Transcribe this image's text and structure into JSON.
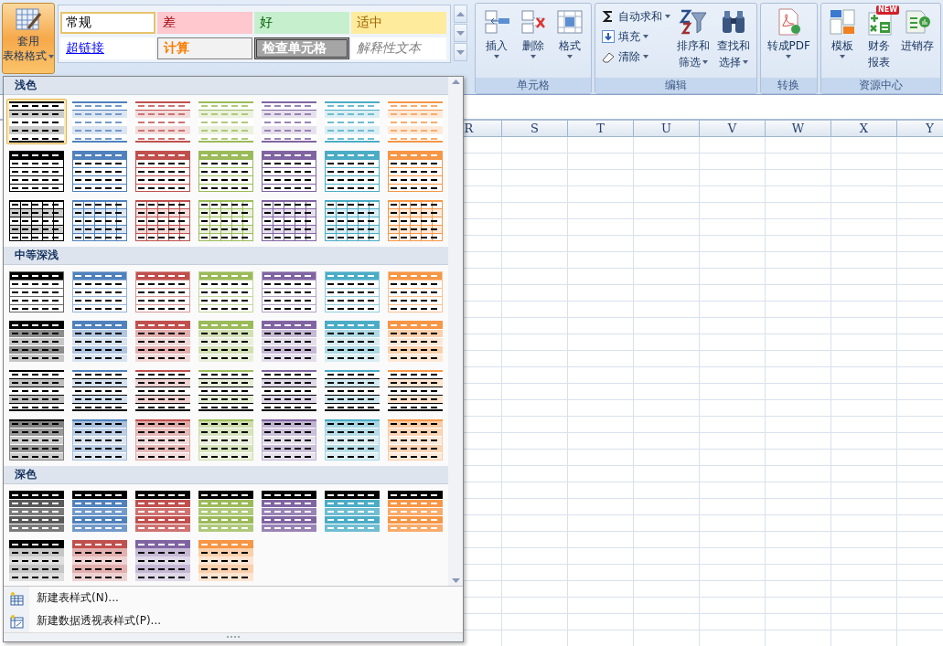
{
  "ribbon": {
    "format_as_table": {
      "lines": [
        "套用",
        "表格格式"
      ],
      "pressed": true,
      "dropdown": true
    },
    "cell_styles": [
      {
        "label": "常规",
        "kind": "normal",
        "selected": true
      },
      {
        "label": "差",
        "kind": "bad",
        "selected": false
      },
      {
        "label": "好",
        "kind": "good",
        "selected": false
      },
      {
        "label": "适中",
        "kind": "neutral",
        "selected": false
      },
      {
        "label": "超链接",
        "kind": "hyperlink",
        "selected": false
      },
      {
        "label": "计算",
        "kind": "calculation",
        "selected": false
      },
      {
        "label": "检查单元格",
        "kind": "check",
        "selected": false
      },
      {
        "label": "解释性文本",
        "kind": "explanatory",
        "selected": false
      }
    ],
    "groups": [
      {
        "label": "单元格",
        "buttons": [
          {
            "kind": "insert",
            "lines": [
              "插入"
            ],
            "dropdown": true
          },
          {
            "kind": "delete",
            "lines": [
              "删除"
            ],
            "dropdown": true
          },
          {
            "kind": "format",
            "lines": [
              "格式"
            ],
            "dropdown": true
          }
        ]
      },
      {
        "label": "编辑",
        "small_buttons": [
          {
            "kind": "sum",
            "label": "自动求和",
            "dropdown": true
          },
          {
            "kind": "fill",
            "label": "填充",
            "dropdown": true
          },
          {
            "kind": "clear",
            "label": "清除",
            "dropdown": true
          }
        ],
        "buttons": [
          {
            "kind": "sort",
            "lines": [
              "排序和",
              "筛选"
            ],
            "dropdown": true
          },
          {
            "kind": "find",
            "lines": [
              "查找和",
              "选择"
            ],
            "dropdown": true
          }
        ]
      },
      {
        "label": "转换",
        "buttons": [
          {
            "kind": "pdf",
            "lines": [
              "转成PDF"
            ],
            "dropdown": true
          }
        ]
      },
      {
        "label": "资源中心",
        "buttons": [
          {
            "kind": "template",
            "lines": [
              "模板"
            ],
            "dropdown": true
          },
          {
            "kind": "finance",
            "lines": [
              "财务",
              "报表"
            ],
            "dropdown": false,
            "badge": "NEW"
          },
          {
            "kind": "inventory",
            "lines": [
              "进销存"
            ],
            "dropdown": false
          }
        ]
      }
    ]
  },
  "sheet": {
    "columns": [
      "R",
      "S",
      "T",
      "U",
      "V",
      "W",
      "X",
      "Y"
    ]
  },
  "table_style_menu": {
    "sections": [
      {
        "title": "浅色",
        "styles": [
          {
            "kind": "light-banded",
            "color": "#000000",
            "selected": true
          },
          {
            "kind": "light-banded",
            "color": "#4f81bd",
            "selected": false
          },
          {
            "kind": "light-banded",
            "color": "#c0504d",
            "selected": false
          },
          {
            "kind": "light-banded",
            "color": "#9bbb59",
            "selected": false
          },
          {
            "kind": "light-banded",
            "color": "#8064a2",
            "selected": false
          },
          {
            "kind": "light-banded",
            "color": "#4bacc6",
            "selected": false
          },
          {
            "kind": "light-banded",
            "color": "#f79646",
            "selected": false
          },
          {
            "kind": "light-header",
            "color": "#000000",
            "selected": false
          },
          {
            "kind": "light-header",
            "color": "#4f81bd",
            "selected": false
          },
          {
            "kind": "light-header",
            "color": "#c0504d",
            "selected": false
          },
          {
            "kind": "light-header",
            "color": "#9bbb59",
            "selected": false
          },
          {
            "kind": "light-header",
            "color": "#8064a2",
            "selected": false
          },
          {
            "kind": "light-header",
            "color": "#4bacc6",
            "selected": false
          },
          {
            "kind": "light-header",
            "color": "#f79646",
            "selected": false
          },
          {
            "kind": "light-grid",
            "color": "#000000",
            "selected": false
          },
          {
            "kind": "light-grid",
            "color": "#4f81bd",
            "selected": false
          },
          {
            "kind": "light-grid",
            "color": "#c0504d",
            "selected": false
          },
          {
            "kind": "light-grid",
            "color": "#9bbb59",
            "selected": false
          },
          {
            "kind": "light-grid",
            "color": "#8064a2",
            "selected": false
          },
          {
            "kind": "light-grid",
            "color": "#4bacc6",
            "selected": false
          },
          {
            "kind": "light-grid",
            "color": "#f79646",
            "selected": false
          }
        ]
      },
      {
        "title": "中等深浅",
        "styles": [
          {
            "kind": "medium-header",
            "color": "#000000",
            "selected": false
          },
          {
            "kind": "medium-header",
            "color": "#4f81bd",
            "selected": false
          },
          {
            "kind": "medium-header",
            "color": "#c0504d",
            "selected": false
          },
          {
            "kind": "medium-header",
            "color": "#9bbb59",
            "selected": false
          },
          {
            "kind": "medium-header",
            "color": "#8064a2",
            "selected": false
          },
          {
            "kind": "medium-header",
            "color": "#4bacc6",
            "selected": false
          },
          {
            "kind": "medium-header",
            "color": "#f79646",
            "selected": false
          },
          {
            "kind": "medium-banded",
            "color": "#000000",
            "selected": false
          },
          {
            "kind": "medium-banded",
            "color": "#4f81bd",
            "selected": false
          },
          {
            "kind": "medium-banded",
            "color": "#c0504d",
            "selected": false
          },
          {
            "kind": "medium-banded",
            "color": "#9bbb59",
            "selected": false
          },
          {
            "kind": "medium-banded",
            "color": "#8064a2",
            "selected": false
          },
          {
            "kind": "medium-banded",
            "color": "#4bacc6",
            "selected": false
          },
          {
            "kind": "medium-banded",
            "color": "#f79646",
            "selected": false
          },
          {
            "kind": "medium-striped",
            "color": "#000000",
            "selected": false
          },
          {
            "kind": "medium-striped",
            "color": "#4f81bd",
            "selected": false
          },
          {
            "kind": "medium-striped",
            "color": "#c0504d",
            "selected": false
          },
          {
            "kind": "medium-striped",
            "color": "#9bbb59",
            "selected": false
          },
          {
            "kind": "medium-striped",
            "color": "#8064a2",
            "selected": false
          },
          {
            "kind": "medium-striped",
            "color": "#4bacc6",
            "selected": false
          },
          {
            "kind": "medium-striped",
            "color": "#f79646",
            "selected": false
          },
          {
            "kind": "medium-tinted",
            "color": "#000000",
            "selected": false
          },
          {
            "kind": "medium-tinted",
            "color": "#4f81bd",
            "selected": false
          },
          {
            "kind": "medium-tinted",
            "color": "#c0504d",
            "selected": false
          },
          {
            "kind": "medium-tinted",
            "color": "#9bbb59",
            "selected": false
          },
          {
            "kind": "medium-tinted",
            "color": "#8064a2",
            "selected": false
          },
          {
            "kind": "medium-tinted",
            "color": "#4bacc6",
            "selected": false
          },
          {
            "kind": "medium-tinted",
            "color": "#f79646",
            "selected": false
          }
        ]
      },
      {
        "title": "深色",
        "styles": [
          {
            "kind": "dark",
            "color": "#595959",
            "selected": false
          },
          {
            "kind": "dark",
            "color": "#4f81bd",
            "selected": false
          },
          {
            "kind": "dark",
            "color": "#c0504d",
            "selected": false
          },
          {
            "kind": "dark",
            "color": "#9bbb59",
            "selected": false
          },
          {
            "kind": "dark",
            "color": "#8064a2",
            "selected": false
          },
          {
            "kind": "dark",
            "color": "#4bacc6",
            "selected": false
          },
          {
            "kind": "dark",
            "color": "#f79646",
            "selected": false
          },
          {
            "kind": "dark-contrast",
            "color": "#000000",
            "selected": false
          },
          {
            "kind": "dark-contrast",
            "color": "#c0504d",
            "selected": false
          },
          {
            "kind": "dark-contrast",
            "color": "#8064a2",
            "selected": false
          },
          {
            "kind": "dark-contrast",
            "color": "#f79646",
            "selected": false
          }
        ]
      }
    ],
    "commands": [
      {
        "kind": "table",
        "label": "新建表样式(N)..."
      },
      {
        "kind": "pivot",
        "label": "新建数据透视表样式(P)..."
      }
    ]
  }
}
